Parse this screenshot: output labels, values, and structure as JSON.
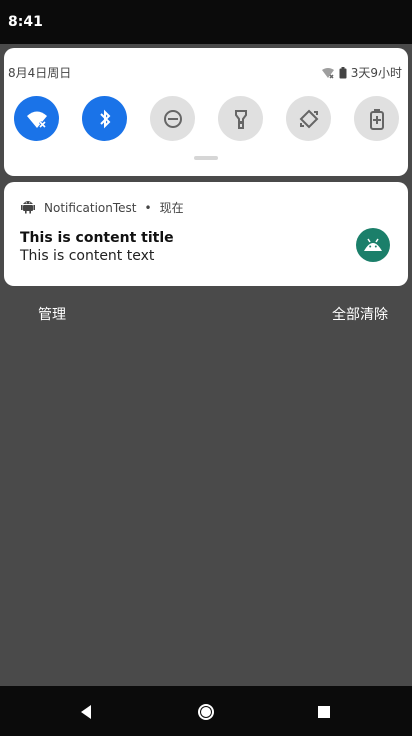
{
  "status_bar": {
    "time": "8:41"
  },
  "quick_settings": {
    "date": "8月4日周日",
    "battery_text": "3天9小时",
    "tiles": [
      {
        "name": "wifi",
        "state": "on"
      },
      {
        "name": "bluetooth",
        "state": "on"
      },
      {
        "name": "do-not-disturb",
        "state": "off"
      },
      {
        "name": "flashlight",
        "state": "off"
      },
      {
        "name": "auto-rotate",
        "state": "off"
      },
      {
        "name": "battery-saver",
        "state": "off"
      }
    ]
  },
  "notification": {
    "app_name": "NotificationTest",
    "separator": "•",
    "time": "现在",
    "title": "This is content title",
    "text": "This is content text"
  },
  "actions": {
    "manage": "管理",
    "clear_all": "全部清除"
  }
}
